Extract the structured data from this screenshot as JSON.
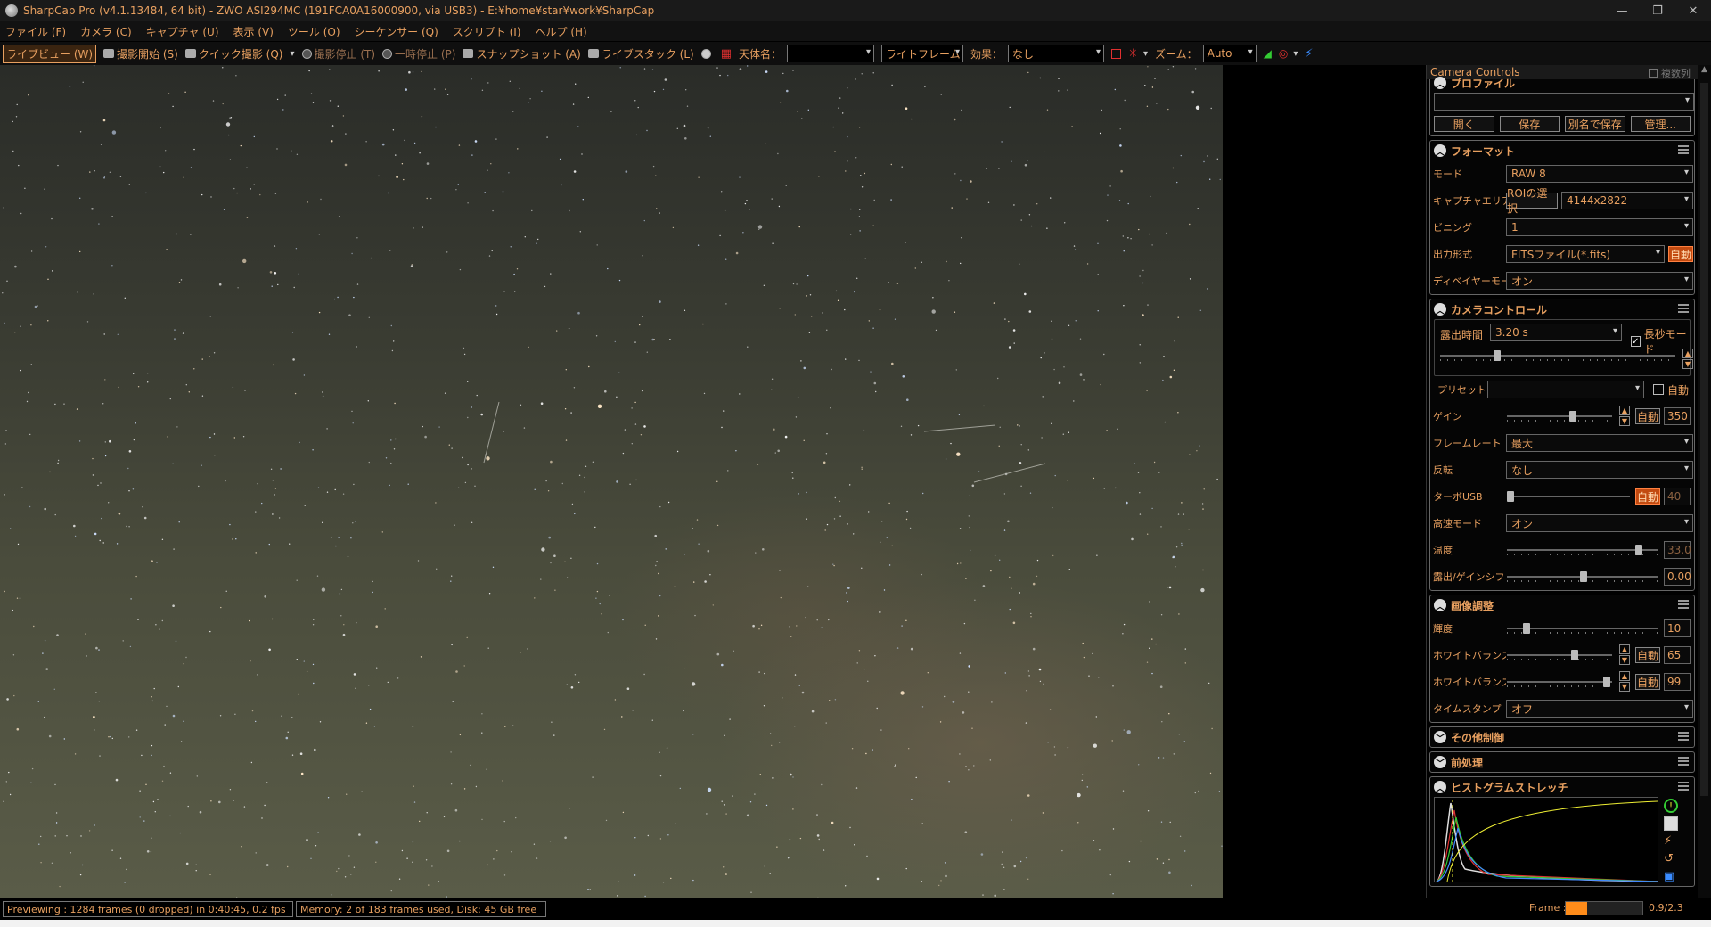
{
  "window": {
    "title": "SharpCap Pro (v4.1.13484, 64 bit) - ZWO ASI294MC (191FCA0A16000900, via USB3) - E:¥home¥star¥work¥SharpCap",
    "minimize": "—",
    "maximize": "❐",
    "close": "✕"
  },
  "menu": [
    "ファイル (F)",
    "カメラ (C)",
    "キャプチャ (U)",
    "表示 (V)",
    "ツール (O)",
    "シーケンサー (Q)",
    "スクリプト (I)",
    "ヘルプ (H)"
  ],
  "toolbar": {
    "live_view": "ライブビュー (W)",
    "start_capture": "撮影開始 (S)",
    "quick_capture": "クイック撮影 (Q)",
    "stop_capture": "撮影停止 (T)",
    "pause": "一時停止 (P)",
    "snapshot": "スナップショット (A)",
    "live_stack": "ライブスタック (L)",
    "target_label": "天体名：",
    "target_value": "",
    "frame_type": "ライトフレーム",
    "effect_label": "効果：",
    "effect_value": "なし",
    "zoom_label": "ズーム：",
    "zoom_value": "Auto"
  },
  "panel": {
    "title": "Camera Controls",
    "multi_column": "複数列",
    "profile": {
      "title": "プロファイル",
      "value": "",
      "open": "開く",
      "save": "保存",
      "save_as": "別名で保存",
      "manage": "管理..."
    },
    "format": {
      "title": "フォーマット",
      "mode_label": "モード",
      "mode_value": "RAW 8",
      "capture_area_label": "キャプチャエリア",
      "roi_button": "ROIの選択",
      "capture_area_value": "4144x2822",
      "binning_label": "ビニング",
      "binning_value": "1",
      "output_label": "出力形式",
      "output_value": "FITSファイル(*.fits)",
      "output_auto": "自動",
      "debayer_label": "ディベイヤーモード",
      "debayer_value": "オン"
    },
    "camera": {
      "title": "カメラコントロール",
      "exposure_label": "露出時間",
      "exposure_value": "3.20 s",
      "long_mode": "長秒モード",
      "preset_label": "プリセット",
      "preset_value": "",
      "preset_auto": "自動",
      "gain_label": "ゲイン",
      "gain_auto": "自動",
      "gain_value": "350",
      "framerate_label": "フレームレート",
      "framerate_value": "最大",
      "flip_label": "反転",
      "flip_value": "なし",
      "turbo_label": "ターボUSB",
      "turbo_auto": "自動",
      "turbo_value": "40",
      "highspeed_label": "高速モード",
      "highspeed_value": "オン",
      "temp_label": "温度",
      "temp_value": "33.0",
      "offset_label": "露出/ゲインシフト",
      "offset_value": "0.00"
    },
    "image": {
      "title": "画像調整",
      "offset_label": "輝度",
      "offset_value": "10",
      "wb_r_label": "ホワイトバランス(R)",
      "wb_r_auto": "自動",
      "wb_r_value": "65",
      "wb_b_label": "ホワイトバランス(B)",
      "wb_b_auto": "自動",
      "wb_b_value": "99",
      "timestamp_label": "タイムスタンプ",
      "timestamp_value": "オフ"
    },
    "misc_title": "その他制御",
    "preproc_title": "前処理",
    "histogram_title": "ヒストグラムストレッチ"
  },
  "status": {
    "previewing": "Previewing : 1284 frames (0 dropped) in 0:40:45, 0.2 fps",
    "memory": "Memory: 2 of 183 frames used, Disk: 45 GB free",
    "frame_label": "Frame :",
    "frame_value": "0.9/2.3",
    "frame_progress": 0.28
  },
  "colors": {
    "accent": "#e8a060",
    "auto_button": "#c24a10"
  }
}
